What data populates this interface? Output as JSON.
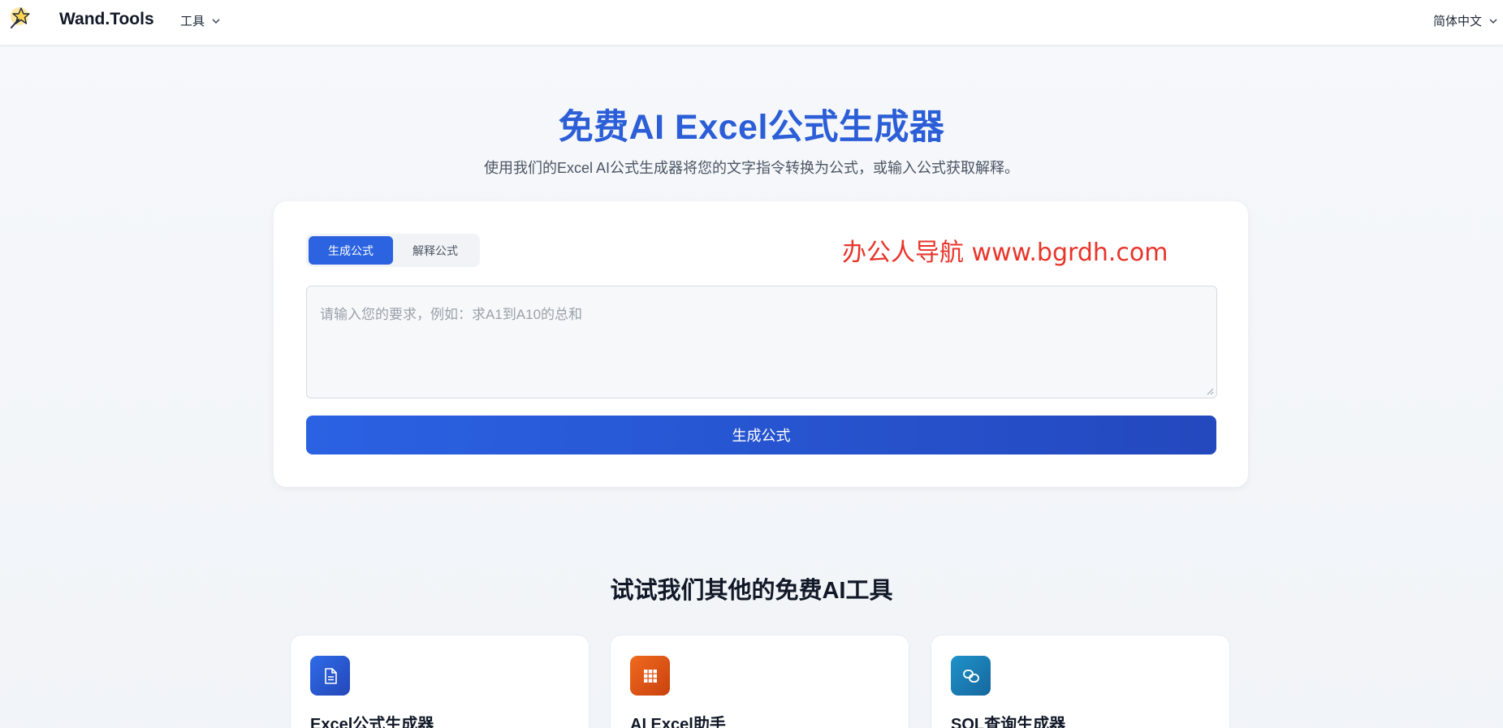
{
  "header": {
    "brand": "Wand.Tools",
    "tools_menu": "工具",
    "language": "简体中文"
  },
  "hero": {
    "title": "免费AI Excel公式生成器",
    "subtitle": "使用我们的Excel AI公式生成器将您的文字指令转换为公式，或输入公式获取解释。"
  },
  "tool": {
    "tabs": [
      {
        "label": "生成公式",
        "active": true
      },
      {
        "label": "解释公式",
        "active": false
      }
    ],
    "watermark": "办公人导航 www.bgrdh.com",
    "input_placeholder": "请输入您的要求，例如：求A1到A10的总和",
    "input_value": "",
    "submit_label": "生成公式"
  },
  "other_tools": {
    "title": "试试我们其他的免费AI工具",
    "items": [
      {
        "name": "Excel公式生成器",
        "icon": "document-icon",
        "color": "#2b5ed7"
      },
      {
        "name": "AI Excel助手",
        "icon": "grid-icon",
        "color": "#e0521b"
      },
      {
        "name": "SQL查询生成器",
        "icon": "link-icon",
        "color": "#1a80b8"
      }
    ]
  },
  "colors": {
    "accent": "#2b5ed7",
    "watermark": "#e8342a"
  }
}
